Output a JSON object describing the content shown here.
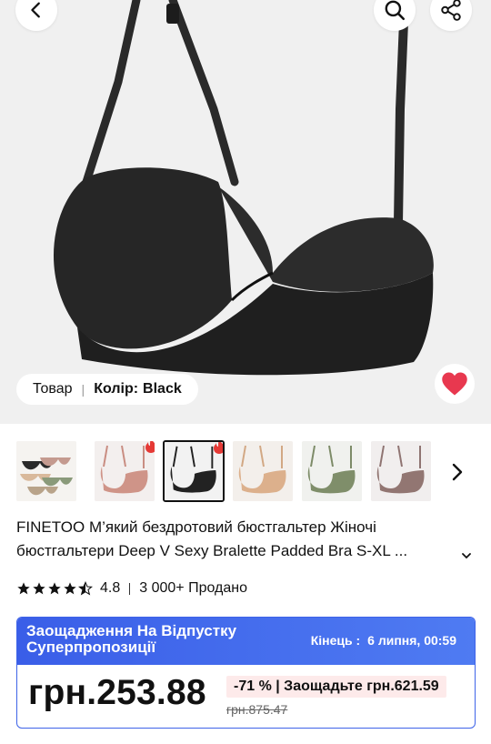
{
  "header": {
    "back_icon": "chevron-left-icon",
    "search_icon": "search-icon",
    "share_icon": "share-icon"
  },
  "variant": {
    "label": "Товар",
    "color_label": "Колір:",
    "color_value": "Black"
  },
  "favorite": {
    "icon": "heart-icon",
    "color": "#e8384f"
  },
  "thumbnails": [
    {
      "name": "assorted",
      "selected": false,
      "hot": false
    },
    {
      "name": "pink",
      "selected": false,
      "hot": true
    },
    {
      "name": "black",
      "selected": true,
      "hot": true
    },
    {
      "name": "beige",
      "selected": false,
      "hot": false
    },
    {
      "name": "green",
      "selected": false,
      "hot": false
    },
    {
      "name": "mauve",
      "selected": false,
      "hot": false
    }
  ],
  "product": {
    "title_line1": "FINETOO М’який бездротовий бюстгальтер Жіночі",
    "title_line2": "бюстгальтери Deep V Sexy Bralette Padded Bra S-XL ..."
  },
  "rating": {
    "score": "4.8",
    "sold": "3 000+ Продано",
    "stars": 4.8
  },
  "promo": {
    "title_line1": "Заощадження На Відпустку",
    "title_line2": "Суперпропозиції",
    "end_label": "Кінець :",
    "end_date": "6 липня, 00:59",
    "price": "грн.253.88",
    "discount": "-71 % | Заощадьте грн.621.59",
    "old_price": "грн.875.47"
  },
  "colors": {
    "promo_blue": "#3a5ee8",
    "heart_red": "#e8384f",
    "flame_red": "#e53935"
  }
}
